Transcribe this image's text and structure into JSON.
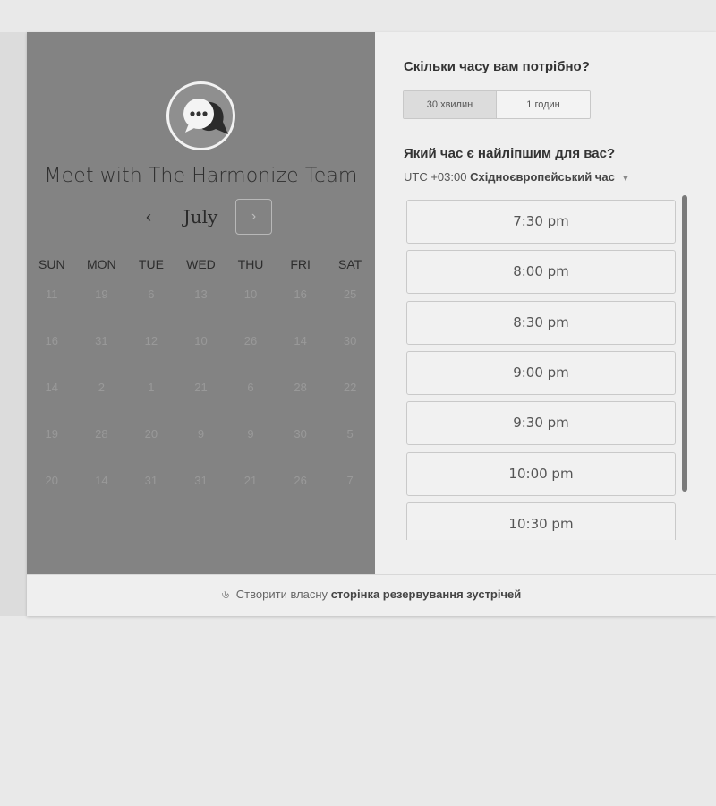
{
  "scheduler": {
    "team_name": "Meet with The Harmonize Team",
    "month": "July",
    "prev_icon": "chevron-left-icon",
    "next_icon": "chevron-right-icon",
    "weekdays": [
      "SUN",
      "MON",
      "TUE",
      "WED",
      "THU",
      "FRI",
      "SAT"
    ],
    "weeks": [
      [
        "11",
        "19",
        "6",
        "13",
        "10",
        "16",
        "25"
      ],
      [
        "16",
        "31",
        "12",
        "10",
        "26",
        "14",
        "30"
      ],
      [
        "14",
        "2",
        "1",
        "21",
        "6",
        "28",
        "22"
      ],
      [
        "19",
        "28",
        "20",
        "9",
        "9",
        "30",
        "5"
      ],
      [
        "20",
        "14",
        "31",
        "31",
        "21",
        "26",
        "7"
      ]
    ]
  },
  "booking": {
    "duration_question": "Скільки часу вам потрібно?",
    "durations": [
      "30 хвилин",
      "1 годин"
    ],
    "selected_duration": "30 хвилин",
    "time_question": "Який час є найліпшим для вас?",
    "timezone_offset": "UTC +03:00",
    "timezone_name": "Східноєвропейський час",
    "slots": [
      "7:30 pm",
      "8:00 pm",
      "8:30 pm",
      "9:00 pm",
      "9:30 pm",
      "10:00 pm",
      "10:30 pm"
    ]
  },
  "footer": {
    "prefix": "Створити власну",
    "link": "сторінка резервування зустрічей"
  }
}
